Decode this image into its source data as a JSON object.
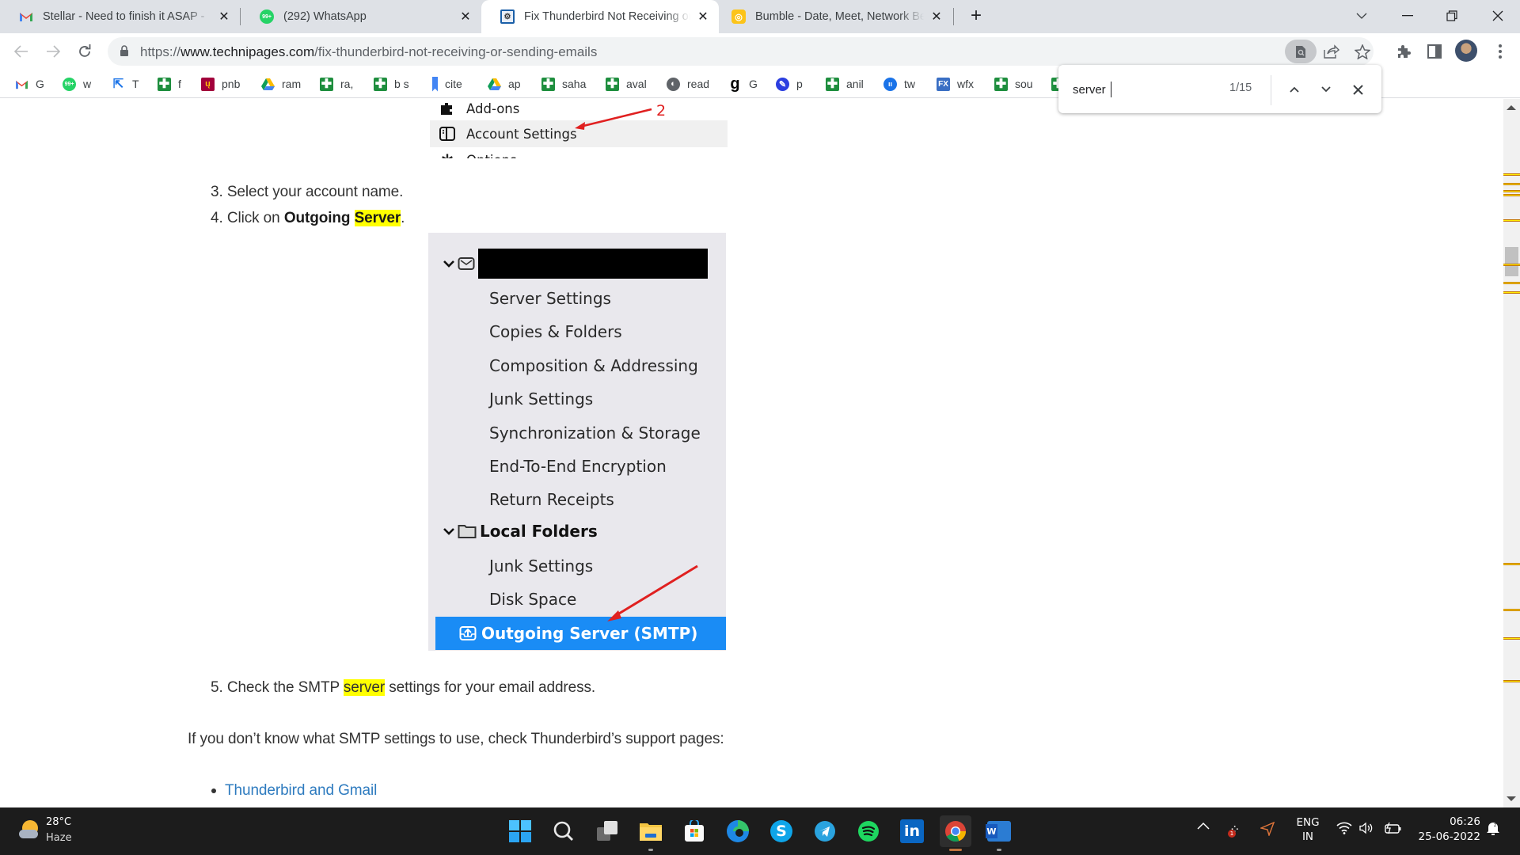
{
  "browser": {
    "tabs": [
      {
        "title": "Stellar - Need to finish it ASAP - ",
        "icon": "gmail-icon",
        "active": false
      },
      {
        "title": "(292) WhatsApp",
        "icon": "whatsapp-icon",
        "badge": "99+",
        "active": false
      },
      {
        "title": "Fix Thunderbird Not Receiving or",
        "icon": "technipages-icon",
        "active": true
      },
      {
        "title": "Bumble - Date, Meet, Network Be",
        "icon": "bumble-icon",
        "active": false
      }
    ],
    "new_tab_label": "+",
    "url_scheme": "https://",
    "url_host": "www.technipages.com",
    "url_path": "/fix-thunderbird-not-receiving-or-sending-emails",
    "bookmarks": [
      {
        "label": "G",
        "icon": "gmail-icon"
      },
      {
        "label": "w",
        "icon": "whatsapp-icon"
      },
      {
        "label": "T",
        "icon": "translate-icon"
      },
      {
        "label": "f",
        "icon": "sheets-icon"
      },
      {
        "label": "pnb",
        "icon": "pnb-icon"
      },
      {
        "label": "ram",
        "icon": "drive-icon"
      },
      {
        "label": "ra,",
        "icon": "sheets-icon"
      },
      {
        "label": "b s",
        "icon": "sheets-icon"
      },
      {
        "label": "cite",
        "icon": "bookmark-icon"
      },
      {
        "label": "ap",
        "icon": "drive-icon"
      },
      {
        "label": "saha",
        "icon": "sheets-icon"
      },
      {
        "label": "aval",
        "icon": "sheets-icon"
      },
      {
        "label": "read",
        "icon": "globe-icon"
      },
      {
        "label": "G",
        "icon": "grammarly-g-icon"
      },
      {
        "label": "p",
        "icon": "pen-icon"
      },
      {
        "label": "anil",
        "icon": "sheets-icon"
      },
      {
        "label": "tw",
        "icon": "tw-icon"
      },
      {
        "label": "wfx",
        "icon": "fx-icon"
      },
      {
        "label": "sou",
        "icon": "sheets-icon"
      }
    ]
  },
  "find_bar": {
    "query": "server",
    "count": "1/15"
  },
  "article": {
    "shot1": {
      "items": [
        "Add-ons",
        "Account Settings",
        "Options"
      ],
      "annotation": "2"
    },
    "step3": {
      "num": "3.",
      "text": "Select your account name."
    },
    "step4": {
      "num": "4.",
      "pre": "Click on ",
      "bold_a": "Outgoing ",
      "bold_hl": "Server",
      "post": "."
    },
    "shot2": {
      "account_items": [
        "Server Settings",
        "Copies & Folders",
        "Composition & Addressing",
        "Junk Settings",
        "Synchronization & Storage",
        "End-To-End Encryption",
        "Return Receipts"
      ],
      "local_folders_label": "Local Folders",
      "local_items": [
        "Junk Settings",
        "Disk Space"
      ],
      "outgoing_label": "Outgoing Server (SMTP)"
    },
    "step5": {
      "num": "5.",
      "pre": "Check the SMTP ",
      "hl": "server",
      "post": " settings for your email address."
    },
    "para": "If you don’t know what SMTP settings to use, check Thunderbird’s support pages:",
    "links": [
      "Thunderbird and Gmail"
    ]
  },
  "scrollbar": {
    "find_match_positions_fraction": [
      0.105,
      0.118,
      0.128,
      0.134,
      0.17,
      0.232,
      0.258,
      0.272,
      0.655,
      0.72,
      0.76,
      0.82
    ]
  },
  "taskbar": {
    "weather_temp": "28°C",
    "weather_desc": "Haze",
    "apps": [
      "start-icon",
      "search-icon",
      "task-view-icon",
      "file-explorer-icon",
      "store-icon",
      "edge-icon",
      "skype-icon",
      "telegram-icon",
      "spotify-icon",
      "linkedin-icon",
      "chrome-icon",
      "word-icon"
    ],
    "lang_top": "ENG",
    "lang_bottom": "IN",
    "time": "06:26",
    "date": "25-06-2022",
    "notification_badge": "1"
  },
  "colors": {
    "highlight": "#ffff00",
    "selection_blue": "#1a8cf5",
    "link": "#2e7bbf",
    "annotation_red": "#e02020"
  }
}
